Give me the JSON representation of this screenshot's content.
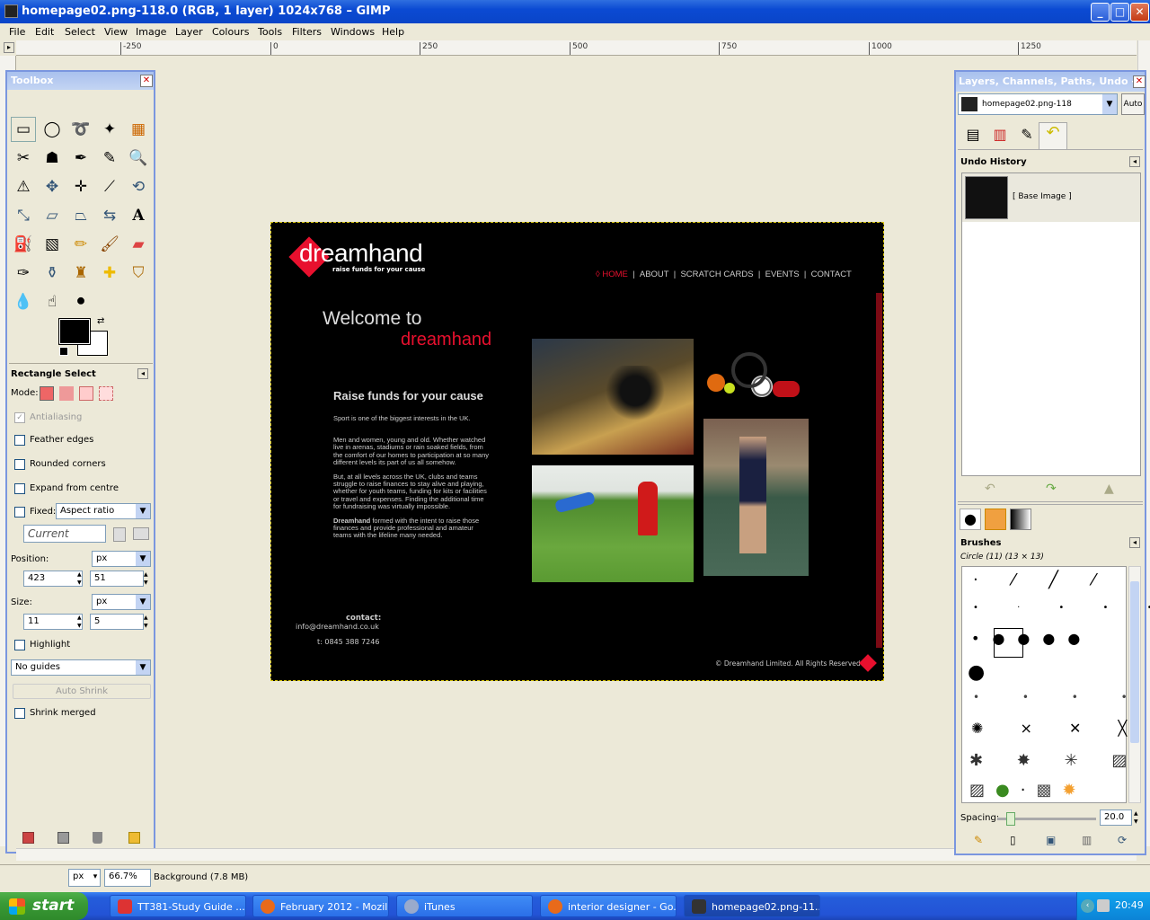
{
  "window": {
    "title": "homepage02.png-118.0 (RGB, 1 layer) 1024x768 – GIMP"
  },
  "menu": [
    "File",
    "Edit",
    "Select",
    "View",
    "Image",
    "Layer",
    "Colours",
    "Tools",
    "Filters",
    "Windows",
    "Help"
  ],
  "ruler": {
    "ticks": [
      "-250",
      "0",
      "250",
      "500",
      "750",
      "1000",
      "1250"
    ]
  },
  "toolbox": {
    "title": "Toolbox",
    "tool_options_title": "Rectangle Select",
    "mode_label": "Mode:",
    "antialiasing": "Antialiasing",
    "feather_edges": "Feather edges",
    "rounded_corners": "Rounded corners",
    "expand_from_centre": "Expand from centre",
    "fixed_label": "Fixed:",
    "fixed_value": "Aspect ratio",
    "current_placeholder": "Current",
    "position_label": "Position:",
    "position_unit": "px",
    "position_x": "423",
    "position_y": "51",
    "size_label": "Size:",
    "size_unit": "px",
    "size_w": "11",
    "size_h": "5",
    "highlight": "Highlight",
    "guides_value": "No guides",
    "auto_shrink": "Auto Shrink",
    "shrink_merged": "Shrink merged"
  },
  "website": {
    "logo_main": "dreamhand",
    "logo_tagline": "raise funds for your cause",
    "nav": [
      "HOME",
      "ABOUT",
      "SCRATCH CARDS",
      "EVENTS",
      "CONTACT"
    ],
    "nav_active": "HOME",
    "welcome_line1": "Welcome to",
    "welcome_line2": "dreamhand",
    "heading": "Raise funds for your cause",
    "para1": "Sport is one of the biggest interests in the UK.",
    "para2": "Men and women, young and old. Whether watched live in arenas, stadiums or rain soaked fields, from the comfort of our homes to participation at so many different levels its part of us all somehow.",
    "para3": "But, at all levels across the UK, clubs and teams struggle to raise finances to stay alive and playing, whether for youth teams, funding for kits or facilities or travel and expenses. Finding the additional time for fundraising was virtually impossible.",
    "para4_bold": "Dreamhand",
    "para4_rest": " formed with the intent to raise those finances and provide professional and amateur teams with the lifeline many needed.",
    "contact_label": "contact:",
    "contact_email": "info@dreamhand.co.uk",
    "contact_phone": "t: 0845 388 7246",
    "copyright": "© Dreamhand Limited. All Rights Reserved"
  },
  "dock": {
    "title": "Layers, Channels, Paths, Undo - B...",
    "image_select": "homepage02.png-118",
    "auto_button": "Auto",
    "undo_title": "Undo History",
    "undo_item": "[ Base Image ]",
    "brushes_title": "Brushes",
    "brush_name": "Circle (11) (13 × 13)",
    "spacing_label": "Spacing:",
    "spacing_value": "20.0"
  },
  "status": {
    "unit": "px",
    "zoom": "66.7%",
    "info": "Background (7.8 MB)"
  },
  "taskbar": {
    "start": "start",
    "tasks": [
      "TT381-Study Guide ...",
      "February 2012 - Mozil...",
      "iTunes",
      "interior designer - Go...",
      "homepage02.png-11..."
    ],
    "clock": "20:49"
  },
  "colors": {
    "accent_red": "#e8102e",
    "xp_blue": "#0b4ad3"
  }
}
